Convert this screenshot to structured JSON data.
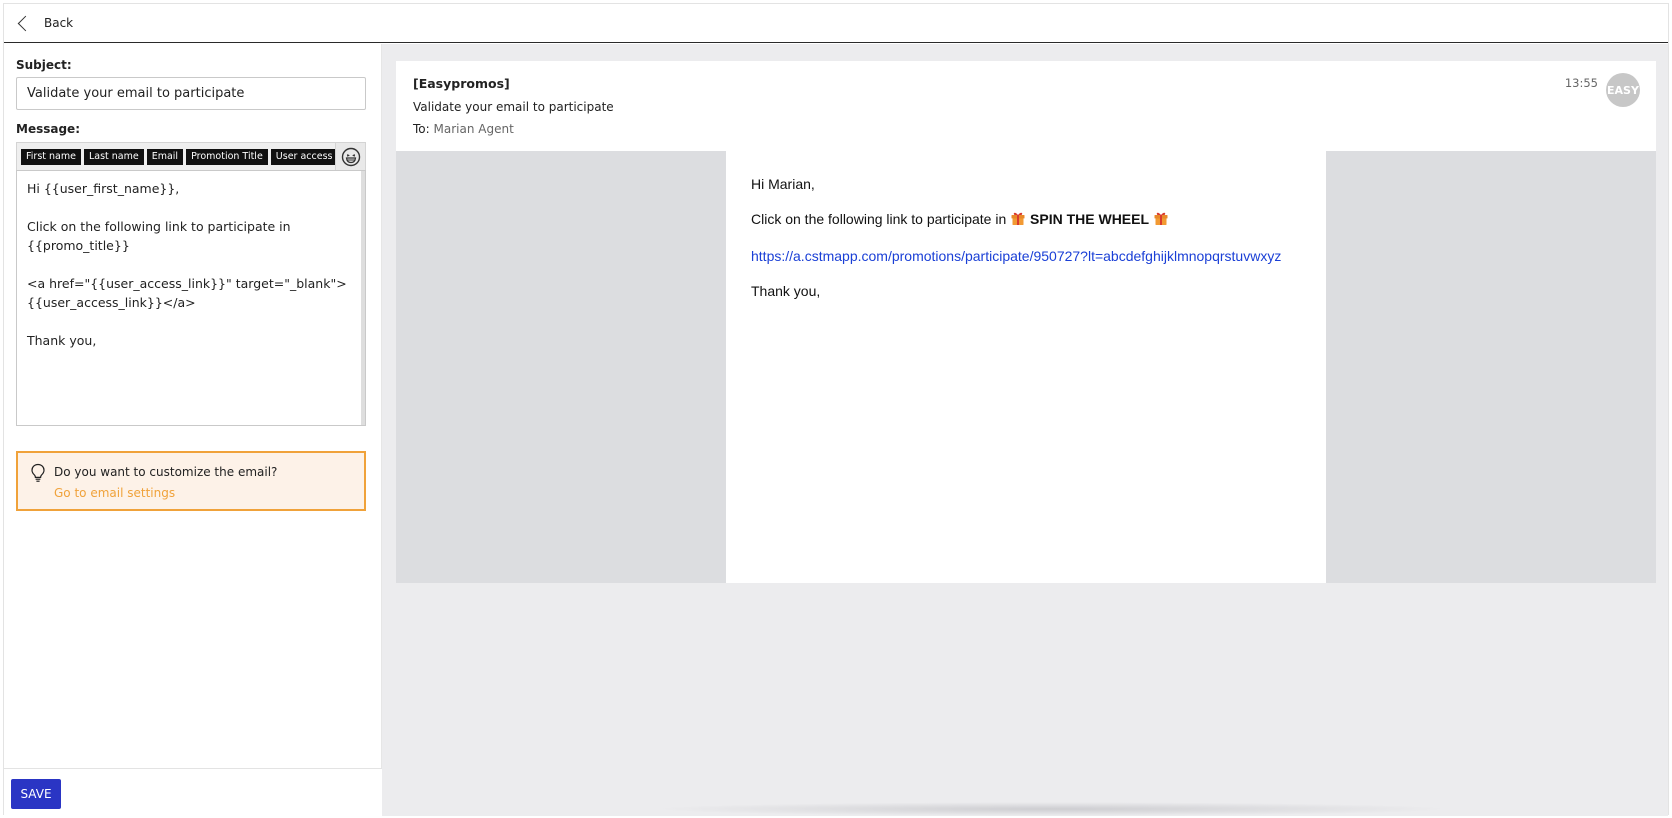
{
  "topbar": {
    "back_label": "Back"
  },
  "editor": {
    "subject_label": "Subject:",
    "subject_value": "Validate your email to participate",
    "message_label": "Message:",
    "tags": [
      "First name",
      "Last name",
      "Email",
      "Promotion Title",
      "User access link"
    ],
    "message_value": "Hi {{user_first_name}},\n\nClick on the following link to participate in {{promo_title}}\n\n<a href=\"{{user_access_link}}\" target=\"_blank\">{{user_access_link}}</a>\n\nThank you,",
    "tip": {
      "title": "Do you want to customize the email?",
      "link": "Go to email settings",
      "accent_color": "#f0a23a"
    },
    "save_label": "SAVE",
    "save_color": "#2a35c4"
  },
  "preview": {
    "sender": "[Easypromos]",
    "subject": "Validate your email to participate",
    "to_label": "To:",
    "to_name": "Marian Agent",
    "time": "13:55",
    "avatar_text": "EASY",
    "body": {
      "greeting": "Hi Marian,",
      "line_prefix": "Click on the following link to participate in",
      "promo_name": "SPIN THE WHEEL",
      "link": "https://a.cstmapp.com/promotions/participate/950727?lt=abcdefghijklmnopqrstuvwxyz",
      "closing": "Thank you,"
    },
    "link_color": "#1a3fd6"
  },
  "icons": {
    "back": "chevron-left-icon",
    "emoji": "smiley-icon",
    "tip": "lightbulb-icon",
    "gift": "gift-icon"
  }
}
